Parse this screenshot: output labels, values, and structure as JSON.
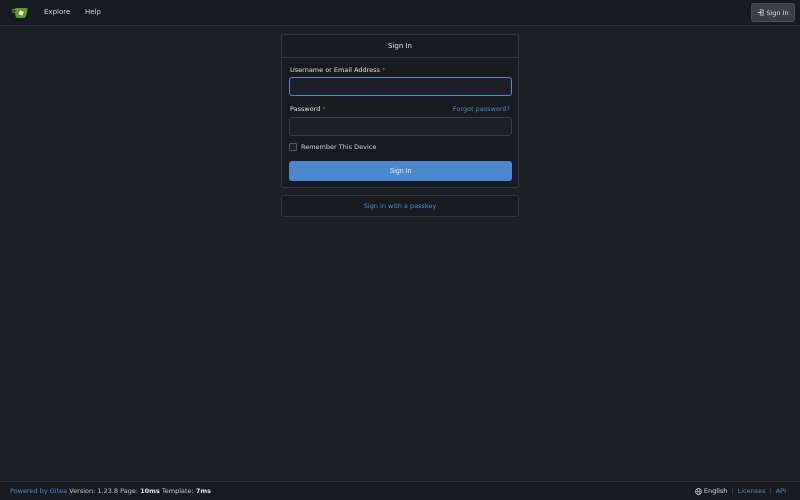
{
  "header": {
    "nav": [
      {
        "label": "Explore"
      },
      {
        "label": "Help"
      }
    ],
    "signin_label": "Sign In"
  },
  "form": {
    "title": "Sign In",
    "username_label": "Username or Email Address",
    "required_mark": "*",
    "username_value": "",
    "password_label": "Password",
    "password_value": "",
    "forgot_label": "Forgot password?",
    "remember_label": "Remember This Device",
    "remember_checked": false,
    "submit_label": "Sign In"
  },
  "passkey": {
    "label": "Sign in with a passkey"
  },
  "footer": {
    "powered_prefix": "Powered by Gitea",
    "version_text": "Version: 1.23.8 Page:",
    "page_time": "10ms",
    "template_label": "Template:",
    "template_time": "7ms",
    "language": "English",
    "licenses_label": "Licenses",
    "api_label": "API"
  },
  "colors": {
    "accent": "#4a87cf",
    "link": "#4e8ed6",
    "background": "#1c1f25",
    "required": "#cc4848"
  },
  "icons": [
    "gitea-logo",
    "sign-in-icon",
    "globe-icon"
  ]
}
